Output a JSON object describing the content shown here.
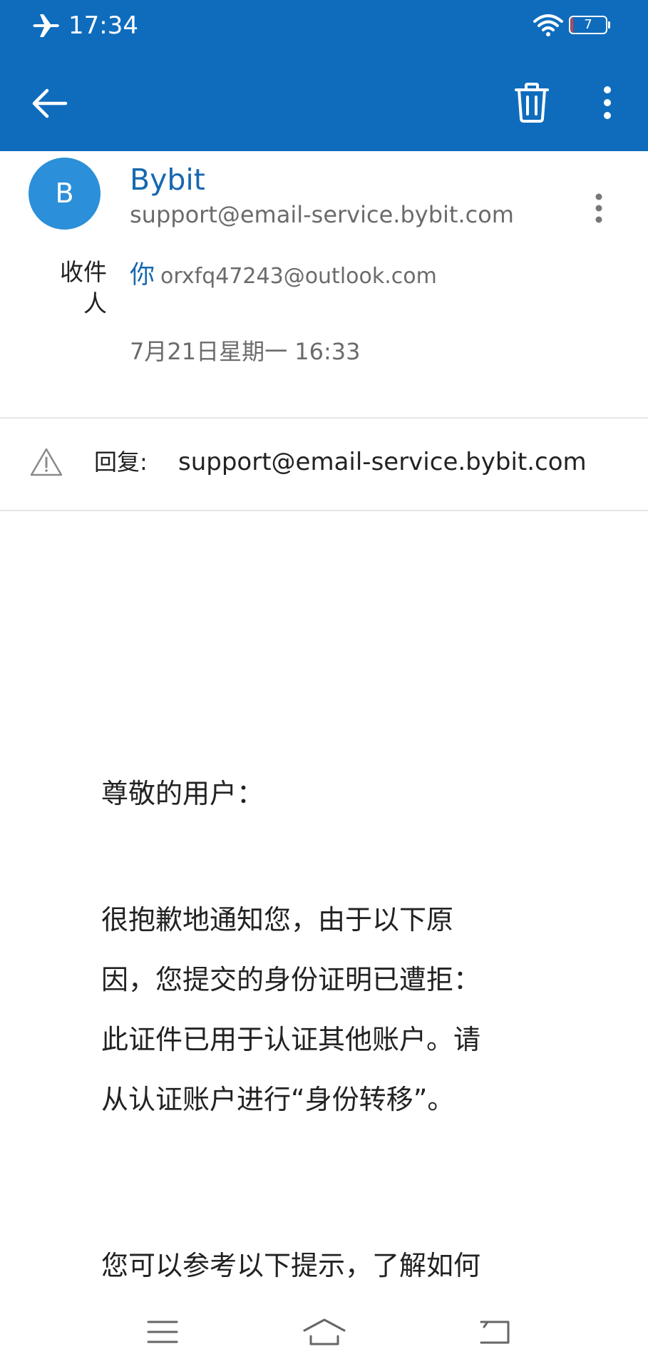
{
  "status_bar": {
    "time": "17:34",
    "battery_level": "7",
    "battery_fraction": 0.07,
    "icons": [
      "airplane-icon",
      "wifi-icon",
      "battery-icon"
    ]
  },
  "toolbar": {
    "icons": [
      "back-arrow-icon",
      "trash-icon",
      "more-vertical-icon"
    ]
  },
  "sender": {
    "avatar_letter": "B",
    "name": "Bybit",
    "email": "support@email-service.bybit.com"
  },
  "recipient": {
    "label_line1": "收件",
    "label_line2": "人",
    "you": "你",
    "email": "orxfq47243@outlook.com"
  },
  "date": "7月21日星期一 16:33",
  "reply_to": {
    "label": "回复:",
    "email": "support@email-service.bybit.com"
  },
  "body": {
    "greeting": "尊敬的用户：",
    "paragraph1_lines": [
      "很抱歉地通知您，由于以下原",
      "因，您提交的身份证明已遭拒：",
      "此证件已用于认证其他账户。请",
      "从认证账户进行“身份转移”。"
    ],
    "paragraph2": "您可以参考以下提示，了解如何"
  },
  "colors": {
    "appbar": "#0f6cbd",
    "accent": "#1668b0",
    "avatar": "#2b8fd9",
    "battery_low": "#e53935"
  },
  "nav": {
    "icons": [
      "menu-icon",
      "home-icon",
      "back-icon"
    ]
  }
}
